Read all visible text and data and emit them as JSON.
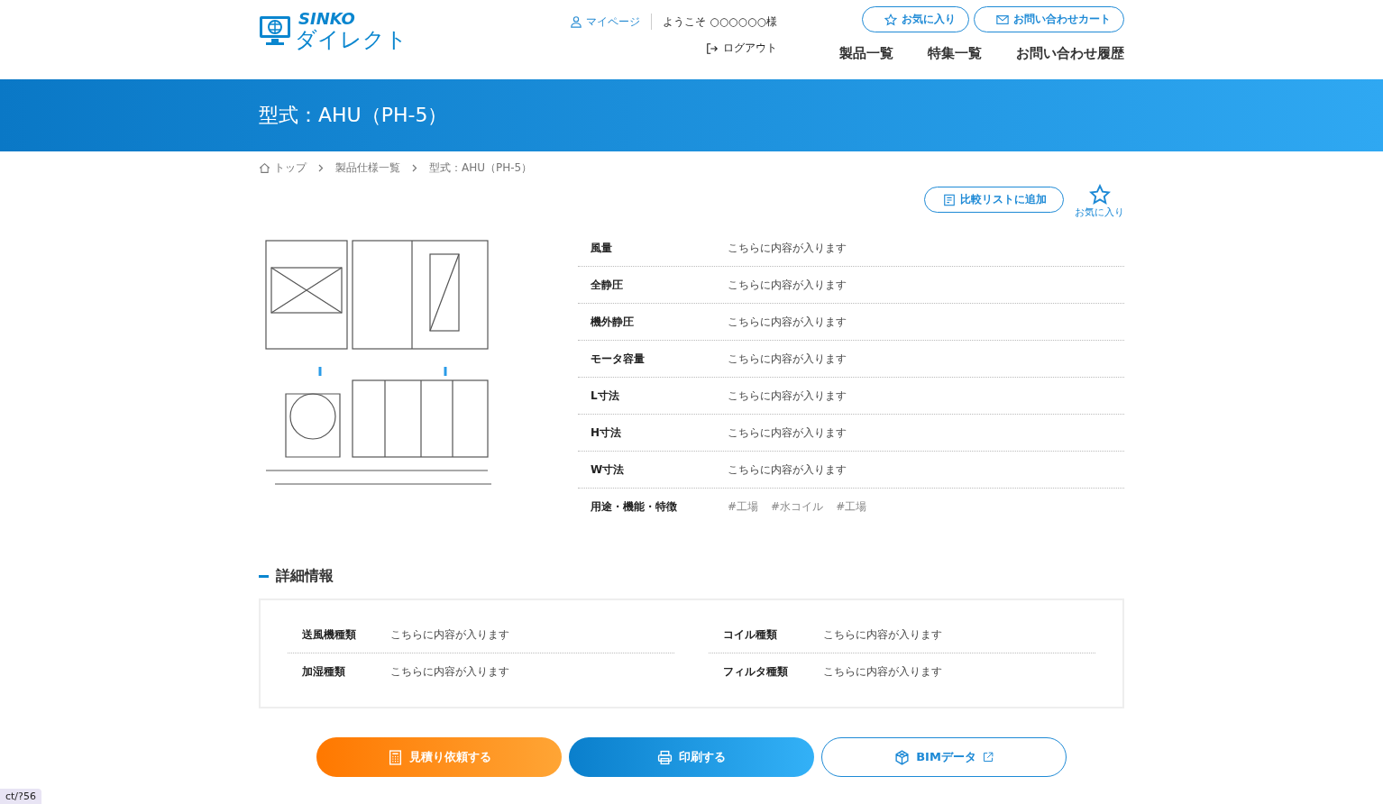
{
  "header": {
    "logo_top": "SINKO",
    "logo_bottom": "ダイレクト",
    "mypage": "マイページ",
    "welcome": "ようこそ ○○○○○○様",
    "logout": "ログアウト",
    "favorites_button": "お気に入り",
    "cart_button": "お問い合わせカート",
    "nav": [
      {
        "label": "製品一覧"
      },
      {
        "label": "特集一覧"
      },
      {
        "label": "お問い合わせ履歴"
      }
    ]
  },
  "page_title": "型式：AHU（PH-5）",
  "breadcrumb": [
    {
      "label": "トップ",
      "kind": "home"
    },
    {
      "label": "製品仕様一覧",
      "kind": "link"
    },
    {
      "label": "型式：AHU（PH-5）",
      "kind": "current"
    }
  ],
  "compare_button": "比較リストに追加",
  "favorite_toggle": {
    "label": "お気に入り",
    "selected": false
  },
  "specs": [
    {
      "label": "風量",
      "value": "こちらに内容が入ります"
    },
    {
      "label": "全静圧",
      "value": "こちらに内容が入ります"
    },
    {
      "label": "機外静圧",
      "value": "こちらに内容が入ります"
    },
    {
      "label": "モータ容量",
      "value": "こちらに内容が入ります"
    },
    {
      "label": "L寸法",
      "value": "こちらに内容が入ります"
    },
    {
      "label": "H寸法",
      "value": "こちらに内容が入ります"
    },
    {
      "label": "W寸法",
      "value": "こちらに内容が入ります"
    },
    {
      "label": "用途・機能・特徴",
      "tags": [
        "#工場",
        "#水コイル",
        "#工場"
      ]
    }
  ],
  "details": {
    "title": "詳細情報",
    "columns": [
      [
        {
          "label": "送風機種類",
          "value": "こちらに内容が入ります"
        },
        {
          "label": "加湿種類",
          "value": "こちらに内容が入ります"
        }
      ],
      [
        {
          "label": "コイル種類",
          "value": "こちらに内容が入ります"
        },
        {
          "label": "フィルタ種類",
          "value": "こちらに内容が入ります"
        }
      ]
    ]
  },
  "actions": [
    {
      "label": "見積り依頼する",
      "kind": "quote"
    },
    {
      "label": "印刷する",
      "kind": "print"
    },
    {
      "label": "BIMデータ",
      "kind": "bim"
    }
  ],
  "status_url": "ct/?56"
}
